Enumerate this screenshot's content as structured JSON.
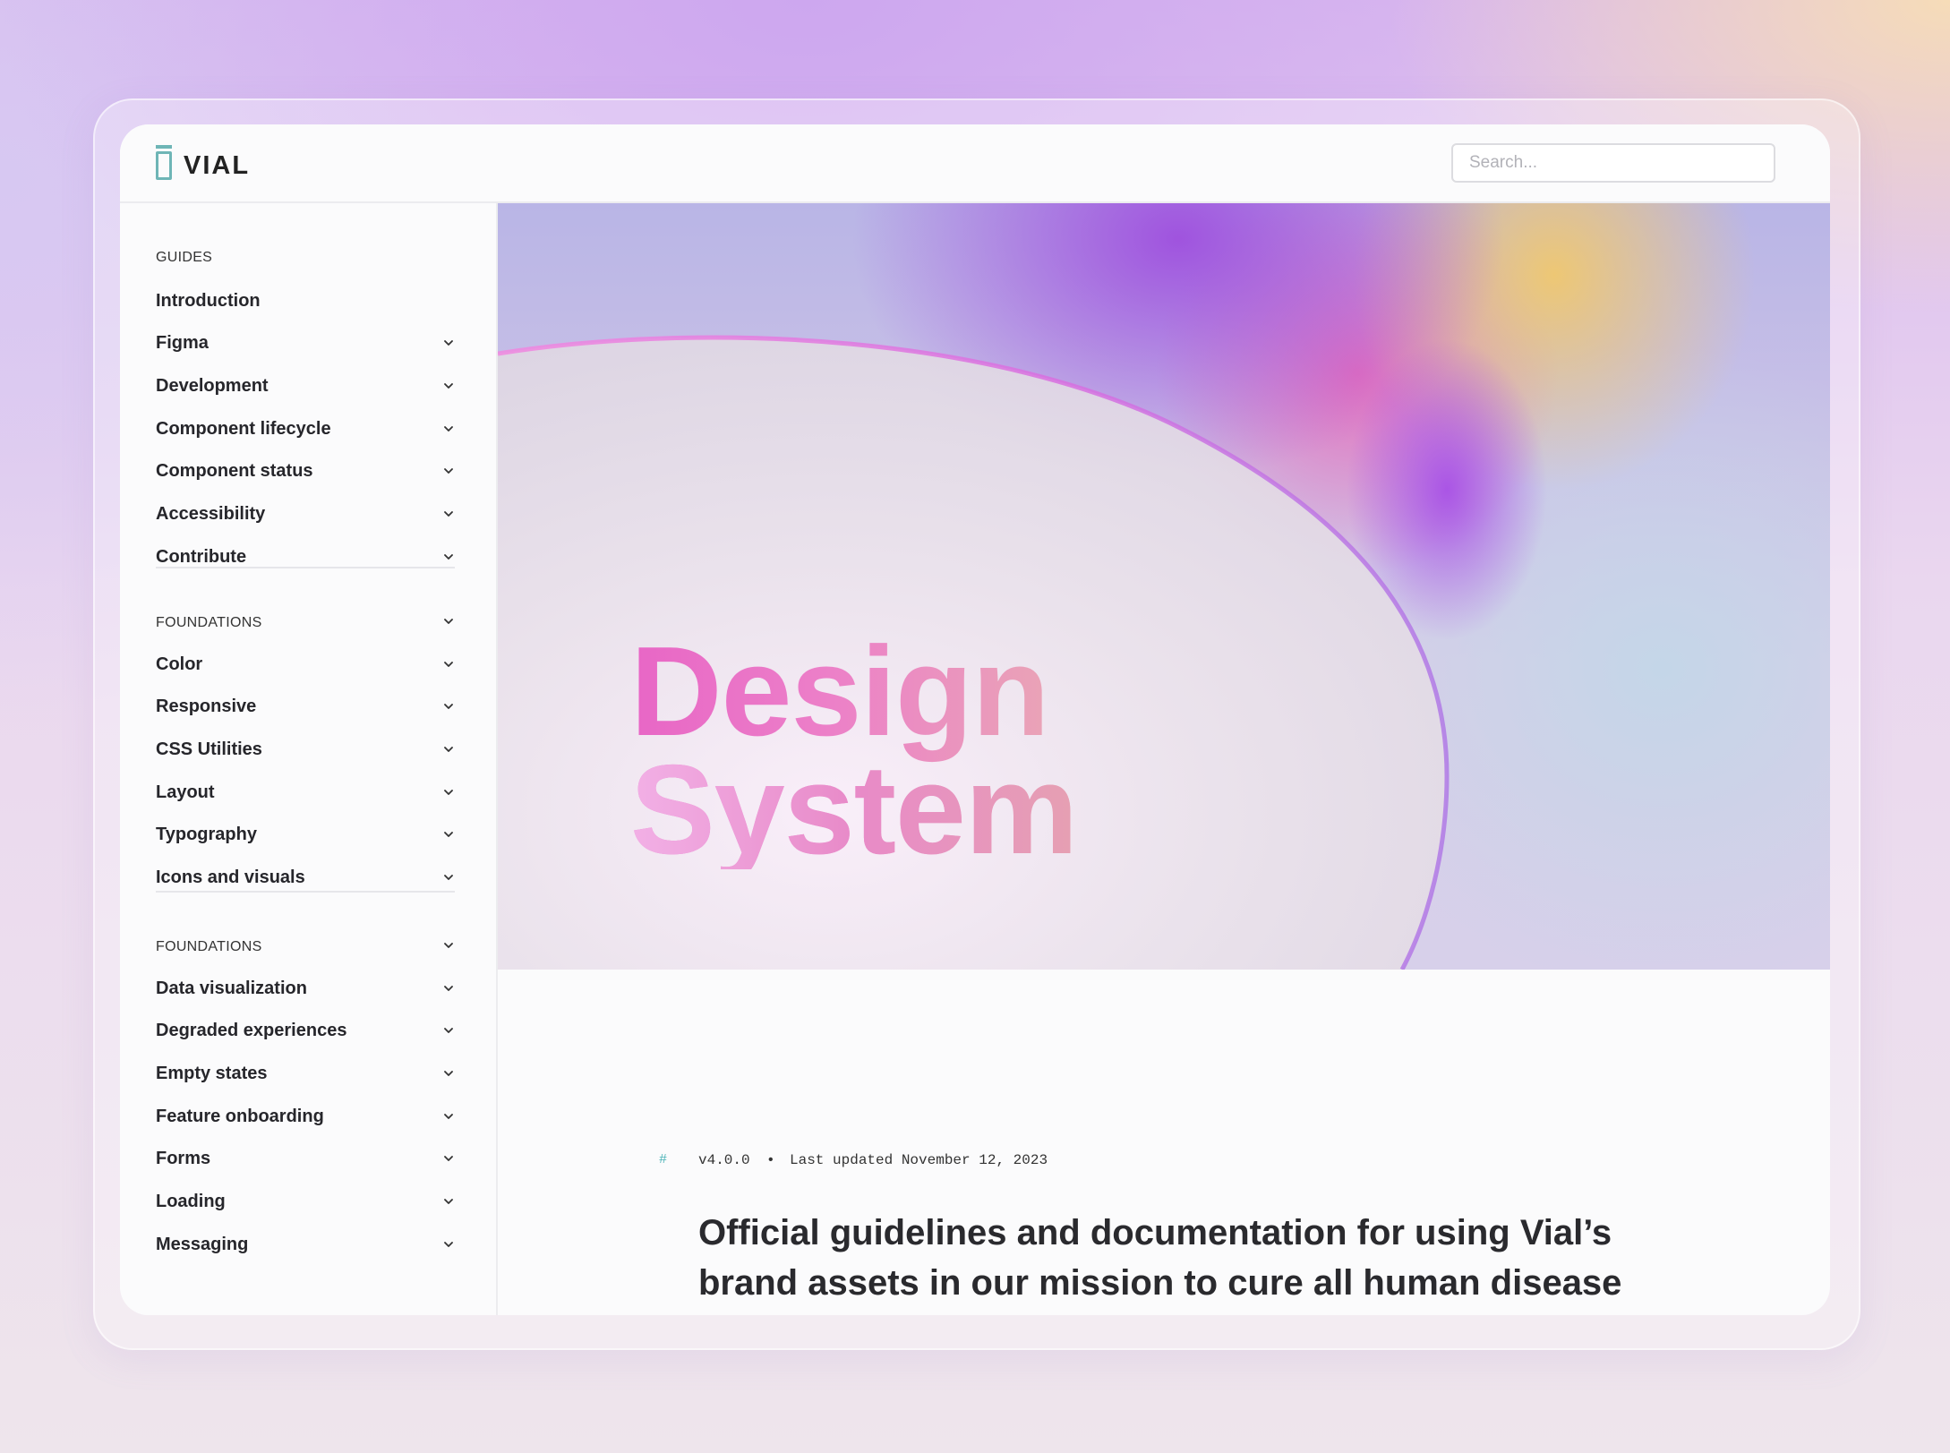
{
  "brand": {
    "name": "VIAL",
    "accent": "#6eb5b6"
  },
  "search": {
    "placeholder": "Search..."
  },
  "sidebar": {
    "sections": [
      {
        "heading": "GUIDES",
        "items": [
          {
            "label": "Introduction",
            "expandable": false
          },
          {
            "label": "Figma",
            "expandable": true
          },
          {
            "label": "Development",
            "expandable": true
          },
          {
            "label": "Component lifecycle",
            "expandable": true
          },
          {
            "label": "Component status",
            "expandable": true
          },
          {
            "label": "Accessibility",
            "expandable": true
          },
          {
            "label": "Contribute",
            "expandable": true
          }
        ]
      },
      {
        "heading": "FOUNDATIONS",
        "items": [
          {
            "label": "Color",
            "expandable": true
          },
          {
            "label": "Responsive",
            "expandable": true
          },
          {
            "label": "CSS Utilities",
            "expandable": true
          },
          {
            "label": "Layout",
            "expandable": true
          },
          {
            "label": "Typography",
            "expandable": true
          },
          {
            "label": "Icons and visuals",
            "expandable": true
          }
        ]
      },
      {
        "heading": "FOUNDATIONS",
        "items": [
          {
            "label": "Data visualization",
            "expandable": true
          },
          {
            "label": "Degraded experiences",
            "expandable": true
          },
          {
            "label": "Empty states",
            "expandable": true
          },
          {
            "label": "Feature onboarding",
            "expandable": true
          },
          {
            "label": "Forms",
            "expandable": true
          },
          {
            "label": "Loading",
            "expandable": true
          },
          {
            "label": "Messaging",
            "expandable": true
          }
        ]
      }
    ]
  },
  "hero": {
    "title_line1": "Design",
    "title_line2": "System"
  },
  "meta": {
    "hash": "#",
    "version": "v4.0.0",
    "separator": "•",
    "updated": "Last updated November 12, 2023"
  },
  "intro": "Official guidelines and documentation for using Vial’s brand assets in our mission to cure all human disease through revolutionizing clinical trials."
}
